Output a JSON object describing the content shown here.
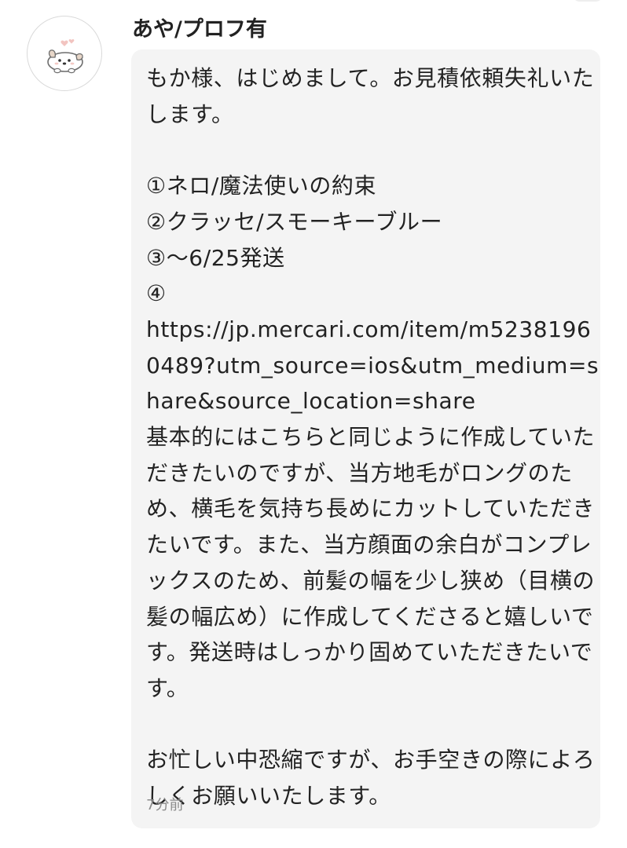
{
  "sender": {
    "name": "あや/プロフ有",
    "avatar_icon": "dog-icon"
  },
  "message": {
    "text": "もか様、はじめまして。お見積依頼失礼いたします。\n\n①ネロ/魔法使いの約束\n②クラッセ/スモーキーブルー\n③〜6/25発送\n④\nhttps://jp.mercari.com/item/m52381960489?utm_source=ios&utm_medium=share&source_location=share\n基本的にはこちらと同じように作成していただきたいのですが、当方地毛がロングのため、横毛を気持ち長めにカットしていただきたいです。また、当方顔面の余白がコンプレックスのため、前髪の幅を少し狭め（目横の髪の幅広め）に作成してくださると嬉しいです。発送時はしっかり固めていただきたいです。\n\nお忙しい中恐縮ですが、お手空きの際によろしくお願いいたします。",
    "timestamp": "7分前"
  },
  "colors": {
    "bubble_background": "#f4f4f4",
    "text": "#222222",
    "timestamp": "#8a8a8a"
  }
}
